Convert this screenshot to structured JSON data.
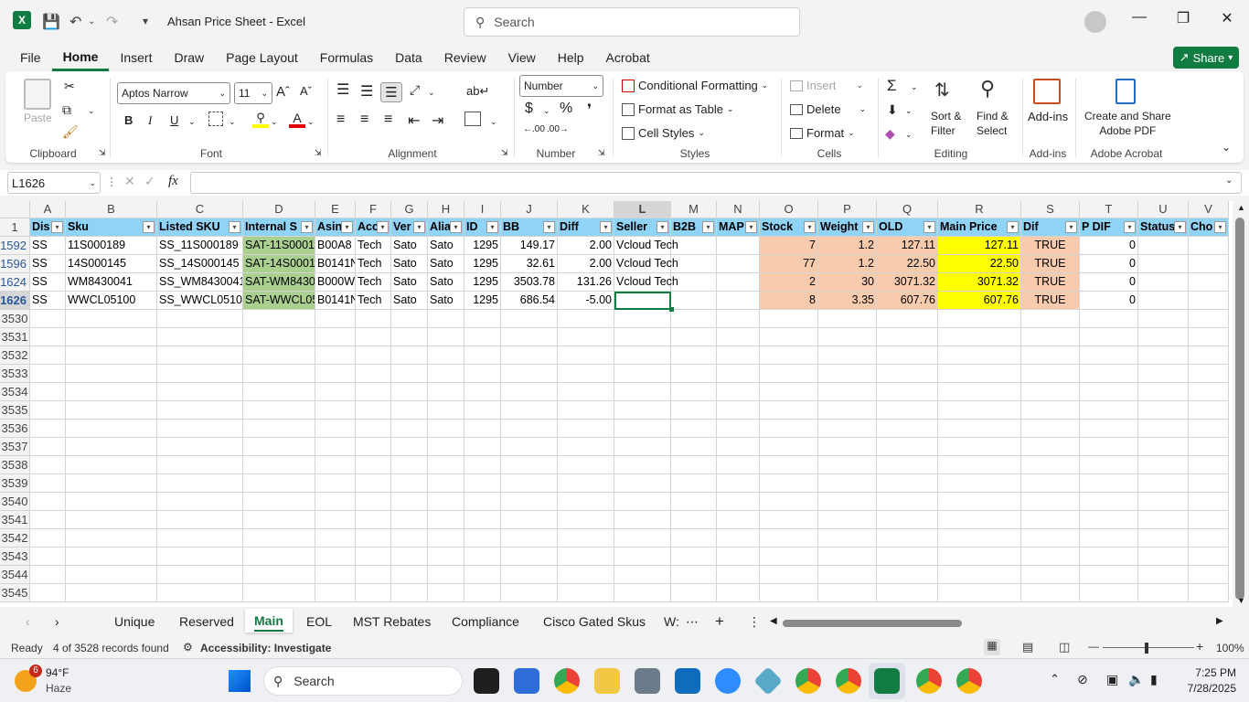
{
  "title": "Ahsan Price Sheet  -  Excel",
  "search_placeholder": "Search",
  "menu": [
    "File",
    "Home",
    "Insert",
    "Draw",
    "Page Layout",
    "Formulas",
    "Data",
    "Review",
    "View",
    "Help",
    "Acrobat"
  ],
  "share": "Share",
  "ribbon": {
    "paste": "Paste",
    "font_name": "Aptos Narrow",
    "font_size": "11",
    "number_format": "Number",
    "conditional_formatting": "Conditional Formatting",
    "format_as_table": "Format as Table",
    "cell_styles": "Cell Styles",
    "insert": "Insert",
    "delete": "Delete",
    "format": "Format",
    "sort_filter_1": "Sort &",
    "sort_filter_2": "Filter",
    "find_select_1": "Find &",
    "find_select_2": "Select",
    "addins": "Add-ins",
    "create_share_1": "Create and Share",
    "create_share_2": "Adobe PDF",
    "groups": {
      "clipboard": "Clipboard",
      "font": "Font",
      "alignment": "Alignment",
      "number": "Number",
      "styles": "Styles",
      "cells": "Cells",
      "editing": "Editing",
      "addins": "Add-ins",
      "acrobat": "Adobe Acrobat"
    }
  },
  "name_box": "L1626",
  "fx": "fx",
  "columns": [
    "A",
    "B",
    "C",
    "D",
    "E",
    "F",
    "G",
    "H",
    "I",
    "J",
    "K",
    "L",
    "M",
    "N",
    "O",
    "P",
    "Q",
    "R",
    "S",
    "T",
    "U",
    "V"
  ],
  "header_row_num": "1",
  "headers": [
    "Dis",
    "Sku",
    "Listed SKU",
    "Internal S",
    "Asin",
    "Acc",
    "Ver",
    "Alia",
    "ID",
    "BB",
    "Diff",
    "Seller",
    "B2B",
    "MAP",
    "Stock",
    "Weight",
    "OLD",
    "Main Price",
    "Dif",
    "P DIF",
    "Status",
    "Cho"
  ],
  "rows": [
    {
      "num": "1592",
      "cells": [
        "SS",
        "11S000189",
        "SS_11S000189",
        "SAT-11S0001",
        "B00A8",
        "Tech",
        "Sato",
        "Sato",
        "1295",
        "149.17",
        "2.00",
        "Vcloud Tech",
        "",
        "",
        "7",
        "1.2",
        "127.11",
        "127.11",
        "TRUE",
        "0",
        "",
        ""
      ]
    },
    {
      "num": "1596",
      "cells": [
        "SS",
        "14S000145",
        "SS_14S000145",
        "SAT-14S0001",
        "B0141N",
        "Tech",
        "Sato",
        "Sato",
        "1295",
        "32.61",
        "2.00",
        "Vcloud Tech",
        "",
        "",
        "77",
        "1.2",
        "22.50",
        "22.50",
        "TRUE",
        "0",
        "",
        ""
      ]
    },
    {
      "num": "1624",
      "cells": [
        "SS",
        "WM8430041",
        "SS_WM8430041",
        "SAT-WM8430",
        "B000W",
        "Tech",
        "Sato",
        "Sato",
        "1295",
        "3503.78",
        "131.26",
        "Vcloud Tech",
        "",
        "",
        "2",
        "30",
        "3071.32",
        "3071.32",
        "TRUE",
        "0",
        "",
        ""
      ]
    },
    {
      "num": "1626",
      "cells": [
        "SS",
        "WWCL05100",
        "SS_WWCL05100",
        "SAT-WWCL05",
        "B0141N",
        "Tech",
        "Sato",
        "Sato",
        "1295",
        "686.54",
        "-5.00",
        "",
        "",
        "",
        "8",
        "3.35",
        "607.76",
        "607.76",
        "TRUE",
        "0",
        "",
        ""
      ]
    }
  ],
  "empty_rows": [
    "3530",
    "3531",
    "3532",
    "3533",
    "3534",
    "3535",
    "3536",
    "3537",
    "3538",
    "3539",
    "3540",
    "3541",
    "3542",
    "3543",
    "3544",
    "3545"
  ],
  "sheets": [
    "Unique",
    "Reserved",
    "Main",
    "EOL",
    "MST Rebates",
    "Compliance",
    "Cisco Gated Skus",
    "W:"
  ],
  "active_sheet": "Main",
  "status": {
    "ready": "Ready",
    "records": "4 of 3528 records found",
    "accessibility": "Accessibility: Investigate",
    "zoom": "100%"
  },
  "taskbar": {
    "temp": "94°F",
    "weather": "Haze",
    "badge": "6",
    "search": "Search",
    "time": "7:25 PM",
    "date": "7/28/2025"
  },
  "colors": {
    "excel_green": "#107c41",
    "header_blue": "#8fd3f7",
    "internal_green": "#a9d08e",
    "stock_peach": "#f8cbad",
    "price_yellow": "#ffff00"
  }
}
